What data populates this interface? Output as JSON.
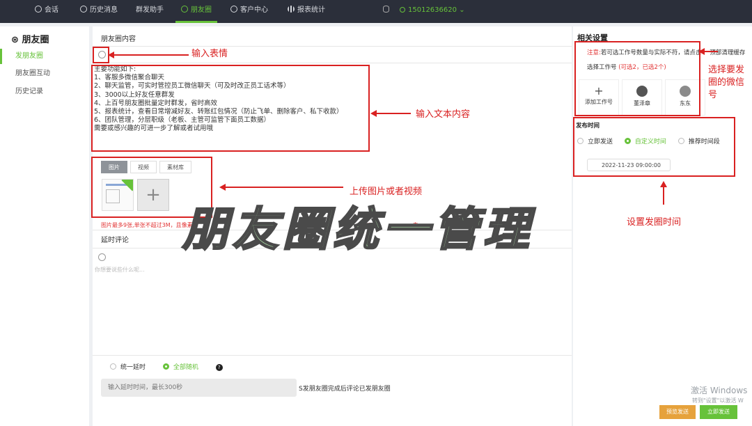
{
  "topnav": {
    "items": [
      {
        "label": "会话",
        "icon": "chat-icon"
      },
      {
        "label": "历史消息",
        "icon": "clock-icon"
      },
      {
        "label": "群发助手",
        "icon": ""
      },
      {
        "label": "朋友圈",
        "icon": "moments-icon",
        "active": true
      },
      {
        "label": "客户中心",
        "icon": "user-icon"
      },
      {
        "label": "报表统计",
        "icon": "bar-chart-icon"
      }
    ],
    "account": "15012636620",
    "accent_color": "#67c23a"
  },
  "sidebar": {
    "title": "朋友圈",
    "items": [
      {
        "label": "发朋友圈",
        "active": true
      },
      {
        "label": "朋友圈互动"
      },
      {
        "label": "历史记录"
      }
    ]
  },
  "main": {
    "title": "朋友圈内容",
    "text_content": "主要功能如下:\n1、客服多微信聚合聊天\n2、聊天监管，可实时管控员工微信聊天（可及时改正员工话术等）\n3、3000以上好友任意群发\n4、上百号朋友圈批量定时群发，省时高效\n5、报表统计，查看日常增减好友、转账红包情况（防止飞单、删除客户、私下收款）\n6、团队管理，分层职级（老板、主管可监管下面员工数据）\n需要或感兴趣的可进一步了解或者试用哦",
    "media_tabs": [
      "图片",
      "视频",
      "素材库"
    ],
    "active_media_tab": "图片",
    "limit_note": "图片最多9张,单张不超过3M，且像素",
    "limit_note_tail": "以",
    "limit_note_tail2": "去",
    "delay_title": "延时评论",
    "comment_placeholder": "你想要说些什么呢...",
    "delay_options": [
      "统一延时",
      "全部随机"
    ],
    "delay_selected": "全部随机",
    "help_glyph": "?",
    "delay_placeholder": "输入延时时间，最长300秒",
    "delay_after_text": "S发朋友圈完成后评论已发朋友圈"
  },
  "right": {
    "title": "相关设置",
    "notice_label": "注意:",
    "notice_text": "若可选工作号数量与实际不符，请点击",
    "notice_tail": "顶部清理缓存",
    "choose_label": "选择工作号",
    "choose_hint": "(可选2，已选2个)",
    "cards": [
      {
        "label": "添加工作号",
        "plus": "+"
      },
      {
        "label": "董泽章"
      },
      {
        "label": "东东"
      }
    ],
    "publish_title": "发布时间",
    "publish_options": [
      "立即发送",
      "自定义时间",
      "推荐时间段"
    ],
    "publish_selected": "自定义时间",
    "publish_time": "2022-11-23 09:00:00",
    "preview_button": "预览发送",
    "send_button": "立即发送"
  },
  "annotations": {
    "emoji": "输入表情",
    "text": "输入文本内容",
    "media": "上传图片或者视频",
    "account_line1": "选择要发",
    "account_line2": "圈的微信",
    "account_line3": "号",
    "time": "设置发圈时间",
    "watermark": "朋友圈统一管理",
    "color": "#d92121"
  },
  "windows_activation": {
    "title": "激活 Windows",
    "subtitle": "转到\"设置\"以激活 W"
  }
}
